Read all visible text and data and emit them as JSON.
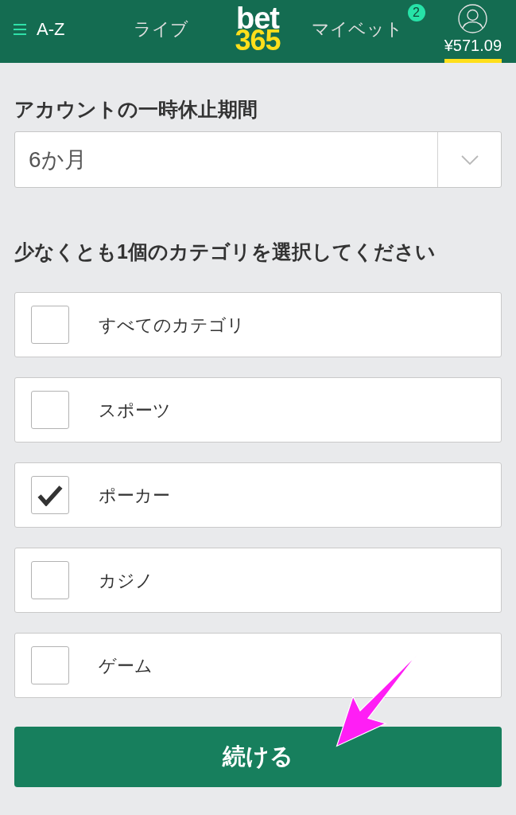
{
  "header": {
    "menu": {
      "label": "A-Z"
    },
    "logo": {
      "line_1": "bet",
      "line_2": "365"
    },
    "tabs": [
      {
        "kind": "text",
        "label": "ライブ",
        "selected": false
      },
      {
        "kind": "text",
        "label": "マイベット",
        "badge": "2",
        "selected": false
      },
      {
        "kind": "account",
        "balance": "¥571.09",
        "selected": true
      }
    ]
  },
  "suspension": {
    "title": "アカウントの一時休止期間",
    "period": {
      "value": "6か月"
    }
  },
  "categories_section": {
    "title": "少なくとも1個のカテゴリを選択してください",
    "categories": [
      {
        "label": "すべてのカテゴリ",
        "checked": false
      },
      {
        "label": "スポーツ",
        "checked": false
      },
      {
        "label": "ポーカー",
        "checked": true
      },
      {
        "label": "カジノ",
        "checked": false
      },
      {
        "label": "ゲーム",
        "checked": false
      }
    ]
  },
  "continue_button": {
    "label": "続ける"
  }
}
